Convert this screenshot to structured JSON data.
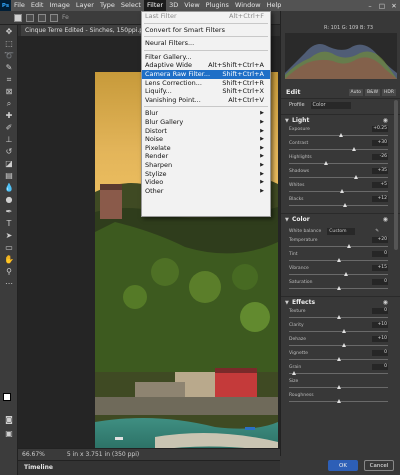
{
  "menubar": {
    "logo": "Ps",
    "items": [
      "File",
      "Edit",
      "Image",
      "Layer",
      "Type",
      "Select",
      "Filter",
      "3D",
      "View",
      "Plugins",
      "Window",
      "Help"
    ],
    "active_index": 6,
    "window_controls": [
      "–",
      "□",
      "✕"
    ]
  },
  "options_bar": {
    "partial_text": "Fe"
  },
  "document": {
    "tab_title": "Cinque Terre Edited - Sinches, 150ppi.p",
    "zoom": "66.67%",
    "doc_info": "5 in x 3.751 in (350 ppi)"
  },
  "timeline": {
    "label": "Timeline"
  },
  "filter_menu": {
    "rows": [
      {
        "label": "Last Filter",
        "shortcut": "Alt+Ctrl+F",
        "disabled": true
      },
      {
        "sep": true
      },
      {
        "label": "Convert for Smart Filters",
        "shortcut": ""
      },
      {
        "sep": true
      },
      {
        "label": "Neural Filters...",
        "shortcut": ""
      },
      {
        "sep": true
      },
      {
        "label": "Filter Gallery...",
        "shortcut": ""
      },
      {
        "label": "Adaptive Wide Angle...",
        "shortcut": "Alt+Shift+Ctrl+A"
      },
      {
        "label": "Camera Raw Filter...",
        "shortcut": "Shift+Ctrl+A",
        "selected": true
      },
      {
        "label": "Lens Correction...",
        "shortcut": "Shift+Ctrl+R"
      },
      {
        "label": "Liquify...",
        "shortcut": "Shift+Ctrl+X"
      },
      {
        "label": "Vanishing Point...",
        "shortcut": "Alt+Ctrl+V"
      },
      {
        "sep": true
      },
      {
        "label": "Blur",
        "submenu": true
      },
      {
        "label": "Blur Gallery",
        "submenu": true
      },
      {
        "label": "Distort",
        "submenu": true
      },
      {
        "label": "Noise",
        "submenu": true
      },
      {
        "label": "Pixelate",
        "submenu": true
      },
      {
        "label": "Render",
        "submenu": true
      },
      {
        "label": "Sharpen",
        "submenu": true
      },
      {
        "label": "Stylize",
        "submenu": true
      },
      {
        "label": "Video",
        "submenu": true
      },
      {
        "label": "Other",
        "submenu": true
      }
    ]
  },
  "histogram": {
    "readout": "R: 101  G: 109  B: 73"
  },
  "camera_raw": {
    "title": "Edit",
    "modes": [
      "Auto",
      "B&W",
      "HDR"
    ],
    "profile_label": "Profile",
    "profile_value": "Color",
    "light": {
      "title": "Light",
      "sliders": [
        {
          "label": "Exposure",
          "value": "+0.25",
          "pos": 0.52
        },
        {
          "label": "Contrast",
          "value": "+30",
          "pos": 0.65
        },
        {
          "label": "Highlights",
          "value": "-26",
          "pos": 0.37
        },
        {
          "label": "Shadows",
          "value": "+35",
          "pos": 0.67
        },
        {
          "label": "Whites",
          "value": "+5",
          "pos": 0.53
        },
        {
          "label": "Blacks",
          "value": "+12",
          "pos": 0.56
        }
      ]
    },
    "color": {
      "title": "Color",
      "wb_label": "White balance",
      "wb_value": "Custom",
      "sliders": [
        {
          "label": "Temperature",
          "value": "+20",
          "pos": 0.6
        },
        {
          "label": "Tint",
          "value": "0",
          "pos": 0.5
        },
        {
          "label": "Vibrance",
          "value": "+15",
          "pos": 0.57
        },
        {
          "label": "Saturation",
          "value": "0",
          "pos": 0.5
        }
      ]
    },
    "effects": {
      "title": "Effects",
      "sliders": [
        {
          "label": "Texture",
          "value": "0",
          "pos": 0.5
        },
        {
          "label": "Clarity",
          "value": "+10",
          "pos": 0.55
        },
        {
          "label": "Dehaze",
          "value": "+10",
          "pos": 0.55
        },
        {
          "label": "Vignette",
          "value": "0",
          "pos": 0.5
        },
        {
          "label": "Grain",
          "value": "0",
          "pos": 0.05
        },
        {
          "label": "Size",
          "value": "",
          "pos": 0.5
        },
        {
          "label": "Roughness",
          "value": "",
          "pos": 0.5
        }
      ]
    },
    "buttons": {
      "ok": "OK",
      "cancel": "Cancel"
    }
  }
}
